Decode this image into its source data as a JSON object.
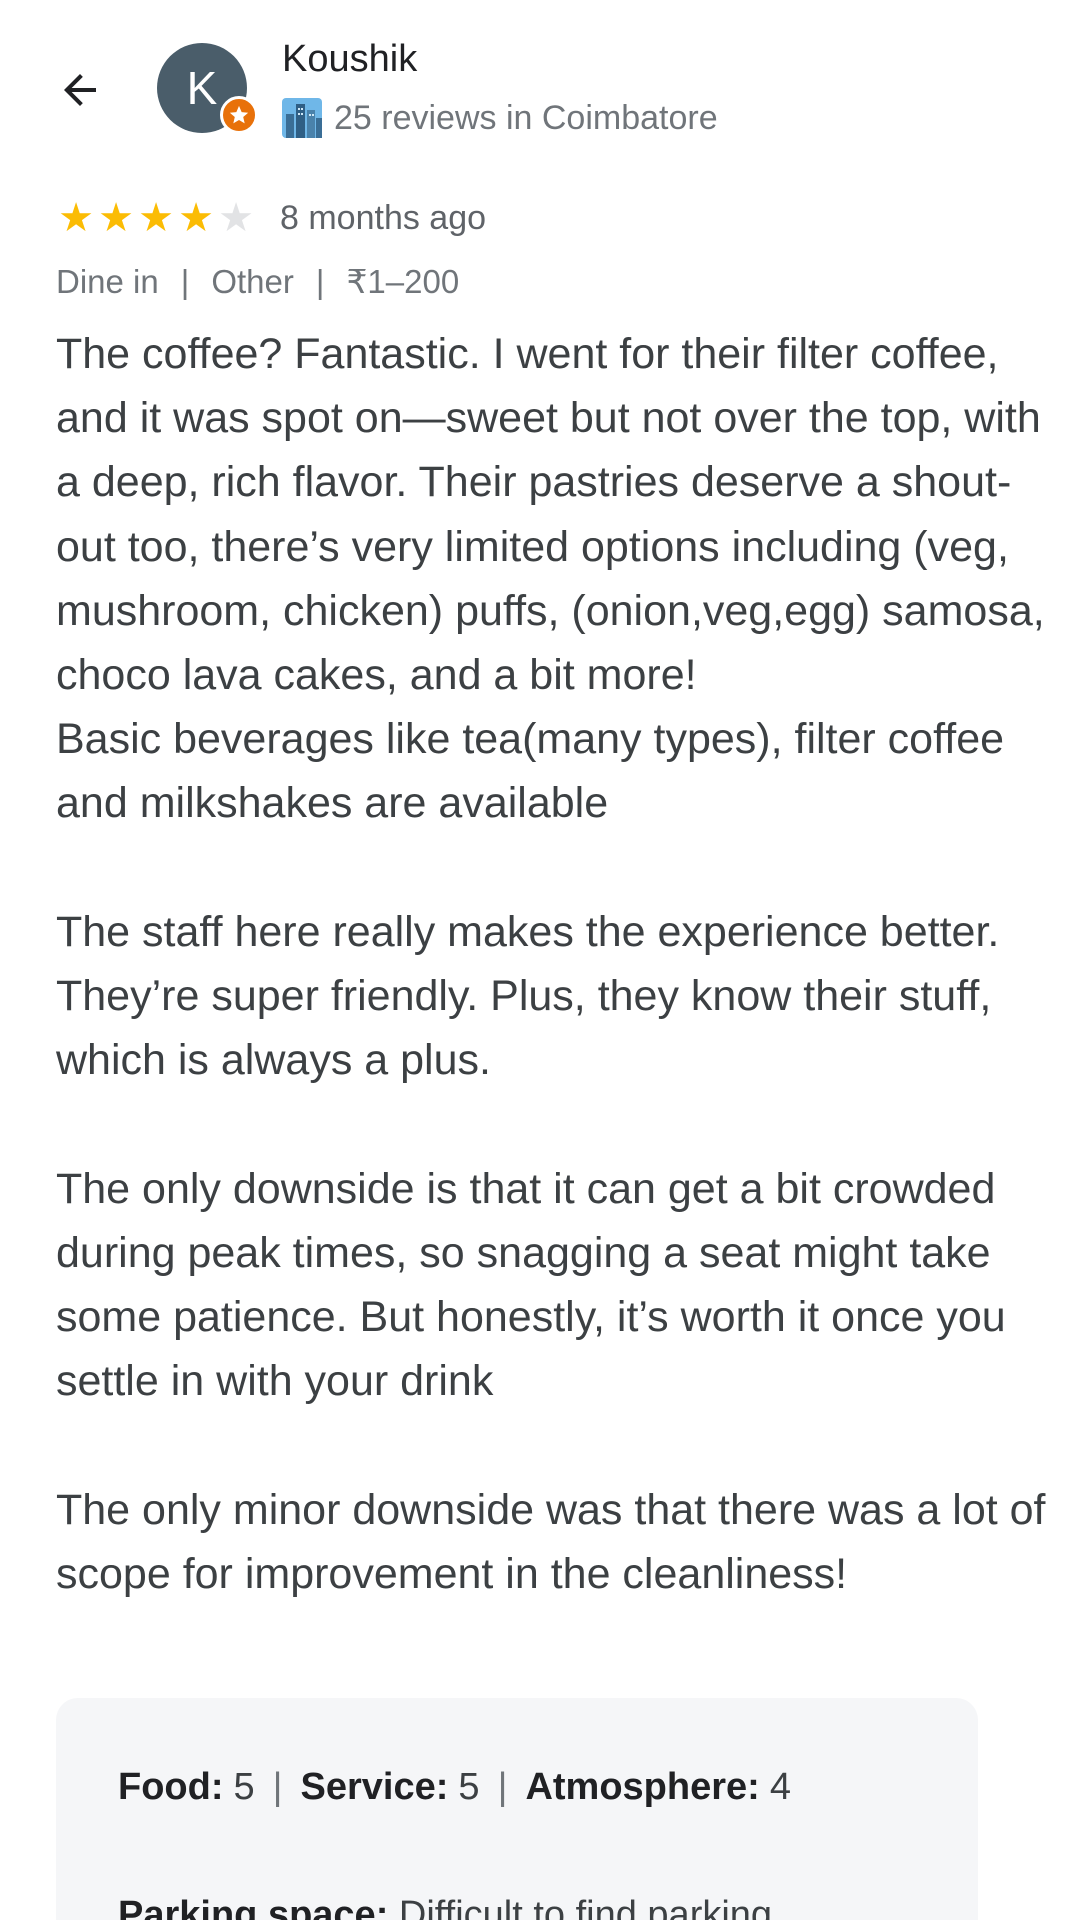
{
  "author": {
    "name": "Koushik",
    "initial": "K",
    "meta": "25 reviews in Coimbatore",
    "meta_icon": "city-icon",
    "badge_icon": "local-guide-star-icon",
    "avatar_color": "#4a5d6a",
    "badge_color": "#e8710a"
  },
  "review": {
    "rating": 4,
    "max_rating": 5,
    "time_ago": "8 months ago",
    "tags": [
      "Dine in",
      "Other",
      "₹1–200"
    ],
    "text": "The coffee? Fantastic. I went for their filter coffee, and it was spot on—sweet but not over the top, with a deep, rich flavor. Their pastries deserve a shout-out too, there’s very limited options including (veg, mushroom, chicken) puffs, (onion,veg,egg) samosa, choco lava cakes, and a bit more!\nBasic beverages like tea(many types), filter coffee and milkshakes are available\n\nThe staff here really makes the experience better. They’re super friendly. Plus, they know their stuff, which is always a plus.\n\nThe only downside is that it can get a bit crowded during peak times, so snagging a seat might take some patience. But honestly, it’s worth it once you settle in with your drink\n\nThe only minor downside was that there was a lot of scope for improvement in the cleanliness!"
  },
  "ratings": {
    "food_label": "Food:",
    "food_value": "5",
    "service_label": "Service:",
    "service_value": "5",
    "atmosphere_label": "Atmosphere:",
    "atmosphere_value": "4",
    "parking_label": "Parking space:",
    "parking_value": "Difficult to find parking"
  },
  "colors": {
    "star_on": "#fbbc04",
    "star_off": "#e2e3e5",
    "card_bg": "#f5f6f8"
  }
}
